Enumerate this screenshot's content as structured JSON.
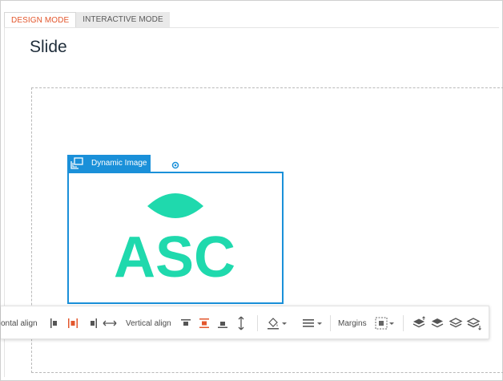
{
  "tabs": [
    {
      "label": "DESIGN MODE",
      "active": true
    },
    {
      "label": "INTERACTIVE MODE",
      "active": false
    }
  ],
  "page_title": "Slide",
  "dynamic_image": {
    "label": "Dynamic Image",
    "logo_text": "ASC"
  },
  "toolbar": {
    "horizontal_align_label": "ontal align",
    "vertical_align_label": "Vertical align",
    "margins_label": "Margins"
  },
  "colors": {
    "accent": "#e3572d",
    "selection": "#1a90d9",
    "logo": "#1fd9ad",
    "active_icon": "#e3572d"
  }
}
